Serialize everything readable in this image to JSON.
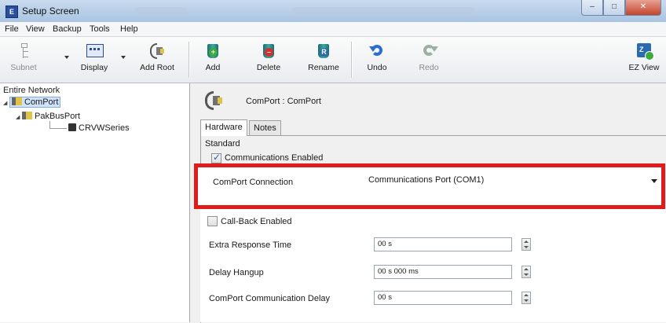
{
  "window": {
    "title": "Setup Screen",
    "minimize": "–",
    "maximize": "□",
    "close": "✕"
  },
  "menu": [
    "File",
    "View",
    "Backup",
    "Tools",
    "Help"
  ],
  "toolbar": {
    "subnet": "Subnet",
    "display": "Display",
    "add_root": "Add Root",
    "add": "Add",
    "delete": "Delete",
    "rename": "Rename",
    "undo": "Undo",
    "redo": "Redo",
    "ez_view": "EZ View"
  },
  "tree": {
    "header": "Entire Network",
    "nodes": [
      "ComPort",
      "PakBusPort",
      "CRVWSeries"
    ]
  },
  "panel": {
    "title": "ComPort : ComPort",
    "tabs": [
      "Hardware",
      "Notes"
    ],
    "section": "Standard",
    "communications_enabled": "Communications Enabled",
    "comport_connection_label": "ComPort Connection",
    "comport_connection_value": "Communications Port (COM1)",
    "callback_enabled": "Call-Back Enabled",
    "extra_response_label": "Extra Response Time",
    "extra_response_value": "00 s",
    "delay_hangup_label": "Delay Hangup",
    "delay_hangup_value": "00 s 000 ms",
    "comm_delay_label": "ComPort Communication Delay",
    "comm_delay_value": "00 s"
  },
  "colors": {
    "highlight": "#e01b1b",
    "selection": "#cfe3fc",
    "accent": "#2a4fa0"
  }
}
